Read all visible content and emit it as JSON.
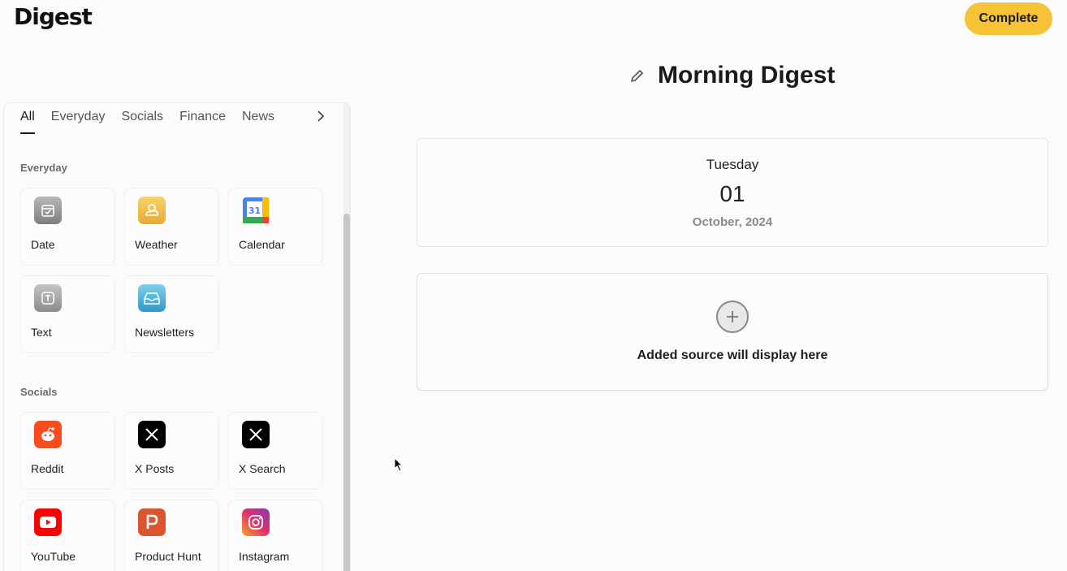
{
  "header": {
    "logo_text": "Digest",
    "complete_label": "Complete"
  },
  "digest": {
    "title": "Morning Digest"
  },
  "tabs": [
    {
      "label": "All",
      "active": true
    },
    {
      "label": "Everyday"
    },
    {
      "label": "Socials"
    },
    {
      "label": "Finance"
    },
    {
      "label": "News"
    }
  ],
  "sections": {
    "everyday": {
      "label": "Everyday",
      "items": [
        {
          "label": "Date",
          "icon": "calendar-check-icon"
        },
        {
          "label": "Weather",
          "icon": "sun-cloud-icon"
        },
        {
          "label": "Calendar",
          "icon": "google-calendar-icon"
        },
        {
          "label": "Text",
          "icon": "text-icon"
        },
        {
          "label": "Newsletters",
          "icon": "inbox-icon"
        }
      ]
    },
    "socials": {
      "label": "Socials",
      "items": [
        {
          "label": "Reddit",
          "icon": "reddit-icon"
        },
        {
          "label": "X Posts",
          "icon": "x-icon"
        },
        {
          "label": "X Search",
          "icon": "x-icon"
        },
        {
          "label": "YouTube",
          "icon": "youtube-icon"
        },
        {
          "label": "Product Hunt",
          "icon": "product-hunt-icon"
        },
        {
          "label": "Instagram",
          "icon": "instagram-icon"
        }
      ]
    }
  },
  "date_card": {
    "day": "Tuesday",
    "date": "01",
    "month_year": "October, 2024"
  },
  "source_placeholder": "Added source will display here",
  "colors": {
    "accent": "#f6c236"
  }
}
